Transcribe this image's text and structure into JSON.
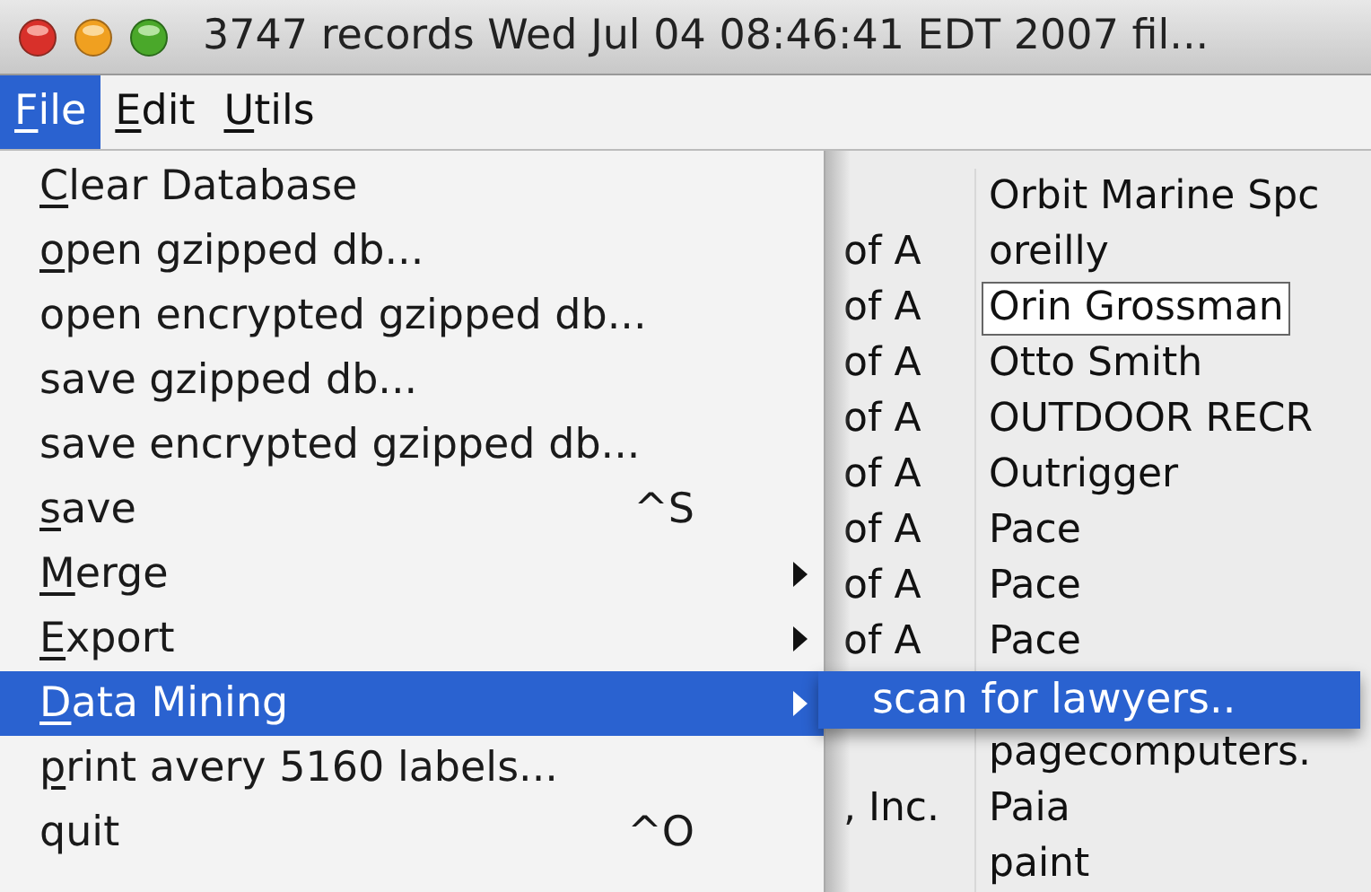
{
  "window": {
    "title": "3747 records Wed Jul 04 08:46:41 EDT 2007 fil..."
  },
  "menubar": [
    {
      "label": "File",
      "selected": true
    },
    {
      "label": "Edit",
      "selected": false
    },
    {
      "label": "Utils",
      "selected": false
    }
  ],
  "file_menu": [
    {
      "label": "Clear Database",
      "underline_first": true,
      "selected": false
    },
    {
      "label": "open gzipped db...",
      "underline_first": true,
      "selected": false
    },
    {
      "label": "open encrypted gzipped db...",
      "underline_first": false,
      "selected": false
    },
    {
      "label": "save gzipped db...",
      "underline_first": false,
      "selected": false
    },
    {
      "label": "save encrypted gzipped db...",
      "underline_first": false,
      "selected": false
    },
    {
      "label": "save",
      "underline_first": true,
      "shortcut": "^S",
      "selected": false
    },
    {
      "label": "Merge",
      "underline_first": true,
      "submenu": true,
      "selected": false
    },
    {
      "label": "Export",
      "underline_first": true,
      "submenu": true,
      "selected": false
    },
    {
      "label": "Data Mining",
      "underline_first": true,
      "submenu": true,
      "selected": true
    },
    {
      "label": "print avery 5160 labels...",
      "underline_first": true,
      "selected": false
    },
    {
      "label": "quit",
      "underline_first": false,
      "shortcut": "^O",
      "selected": false
    }
  ],
  "submenu": [
    {
      "label": "scan for lawyers..",
      "selected": true
    }
  ],
  "table": {
    "rows": [
      {
        "column_2": "Orbit Marine Spc"
      },
      {
        "column_1": "of A",
        "column_2": "oreilly"
      },
      {
        "column_1": "of A",
        "column_2": "Orin Grossman",
        "editing": true
      },
      {
        "column_1": "of A",
        "column_2": "Otto Smith"
      },
      {
        "column_1": "of A",
        "column_2": "OUTDOOR RECR"
      },
      {
        "column_1": "of A",
        "column_2": "Outrigger"
      },
      {
        "column_1": "of A",
        "column_2": "Pace"
      },
      {
        "column_1": "of A",
        "column_2": "Pace"
      },
      {
        "column_1": "of A",
        "column_2": "Pace"
      },
      {
        "hidden": true
      },
      {
        "column_2": "pagecomputers."
      },
      {
        "column_1": ", Inc.",
        "column_2": "Paia"
      },
      {
        "column_2": "paint"
      }
    ]
  }
}
